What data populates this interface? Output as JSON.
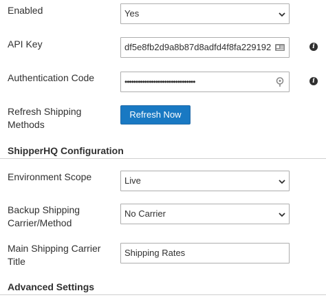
{
  "fields": {
    "enabled": {
      "label": "Enabled",
      "value": "Yes"
    },
    "api_key": {
      "label": "API Key",
      "value": "df5e8fb2d9a8b87d8adfd4f8fa229192"
    },
    "auth_code": {
      "label": "Authentication Code",
      "value": "••••••••••••••••••••••••••••••••"
    },
    "refresh": {
      "label_line1": "Refresh Shipping",
      "label_line2": "Methods",
      "button": "Refresh Now"
    }
  },
  "sections": {
    "shipperhq_config": "ShipperHQ Configuration",
    "advanced_settings": "Advanced Settings"
  },
  "config": {
    "environment_scope": {
      "label": "Environment Scope",
      "value": "Live"
    },
    "backup_carrier": {
      "label_line1": "Backup Shipping",
      "label_line2": "Carrier/Method",
      "value": "No Carrier"
    },
    "main_carrier_title": {
      "label_line1": "Main Shipping Carrier",
      "label_line2": "Title",
      "value": "Shipping Rates"
    }
  },
  "icons": {
    "info": "info-icon",
    "card": "id-card-icon",
    "key": "key-icon",
    "chevron": "chevron-down-icon"
  },
  "colors": {
    "button_bg": "#1979c3",
    "text": "#303030",
    "border": "#adadad"
  }
}
